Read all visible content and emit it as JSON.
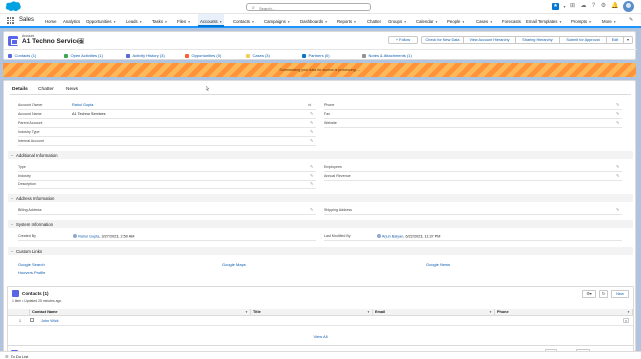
{
  "global_header": {
    "search_placeholder": "Search...",
    "utility_icons": [
      "favorites-star-icon",
      "add-icon",
      "help-icon",
      "setup-gear-icon",
      "notification-bell-icon"
    ]
  },
  "nav": {
    "app_name": "Sales",
    "items": [
      "Home",
      "Analytics",
      "Opportunities",
      "Leads",
      "Tasks",
      "Files",
      "Accounts",
      "Contacts",
      "Campaigns",
      "Dashboards",
      "Reports",
      "Chatter",
      "Groups",
      "Calendar",
      "People",
      "Cases",
      "Forecasts",
      "Email Templates",
      "Prompts",
      "More"
    ],
    "active": "Accounts"
  },
  "record": {
    "object_type": "Account",
    "title": "A1 Techno Services",
    "buttons": [
      "+ Follow",
      "Check for New Data",
      "View Account Hierarchy",
      "Sharing Hierarchy",
      "Submit for Approval",
      "Edit"
    ],
    "quick_links": [
      {
        "label": "Contacts (1)",
        "color": "#5867e8"
      },
      {
        "label": "Open Activities (1)",
        "color": "#3ba755"
      },
      {
        "label": "Activity History (3)",
        "color": "#5867e8"
      },
      {
        "label": "Opportunities (0)",
        "color": "#ff5d2d"
      },
      {
        "label": "Cases (3)",
        "color": "#f2cf5b"
      },
      {
        "label": "Partners (0)",
        "color": "#0176d3"
      },
      {
        "label": "Notes & Attachments (1)",
        "color": "#939393"
      }
    ]
  },
  "banner": {
    "text": "Summarizing your data for access is processing ..."
  },
  "tabs": [
    "Details",
    "Chatter",
    "News"
  ],
  "details": {
    "left_fields": [
      {
        "label": "Account Owner",
        "value": "Rahul Gupta",
        "link": true
      },
      {
        "label": "Account Name",
        "value": "A1 Techno Services",
        "link": false
      },
      {
        "label": "Parent Account",
        "value": "",
        "link": false
      },
      {
        "label": "Industry Type",
        "value": "",
        "link": false
      },
      {
        "label": "Internal Account",
        "value": "",
        "link": false
      }
    ],
    "right_fields": [
      {
        "label": "Phone",
        "value": ""
      },
      {
        "label": "Fax",
        "value": ""
      },
      {
        "label": "Website",
        "value": ""
      }
    ],
    "additional_section": "Additional Information",
    "additional_left": [
      "Type",
      "Industry",
      "Description"
    ],
    "additional_right": [
      "Employees",
      "Annual Revenue"
    ],
    "address_section": "Address Information",
    "billing_label": "Billing Address",
    "shipping_label": "Shipping Address",
    "system_section": "System Information",
    "created_by_label": "Created By",
    "created_by_user": "Rahul Gupta",
    "created_by_date": ", 3/27/2023, 2:50 AM",
    "modified_by_label": "Last Modified By",
    "modified_by_user": "Arjun Balyan",
    "modified_by_date": ", 6/22/2023, 11:37 PM",
    "custom_links_section": "Custom Links",
    "custom_links": [
      "Google Search",
      "Google Maps",
      "Google News",
      "Hoovers Profile"
    ]
  },
  "contacts_list": {
    "title": "Contacts (1)",
    "subtitle": "1 item • Updated 25 minutes ago",
    "new_label": "New",
    "columns": [
      "Contact Name",
      "Title",
      "Email",
      "Phone"
    ],
    "rows": [
      {
        "num": "1",
        "name": "John Wick",
        "title": "",
        "email": "",
        "phone": ""
      }
    ],
    "view_all": "View All"
  },
  "utility_bar": {
    "label": "To Do List"
  }
}
